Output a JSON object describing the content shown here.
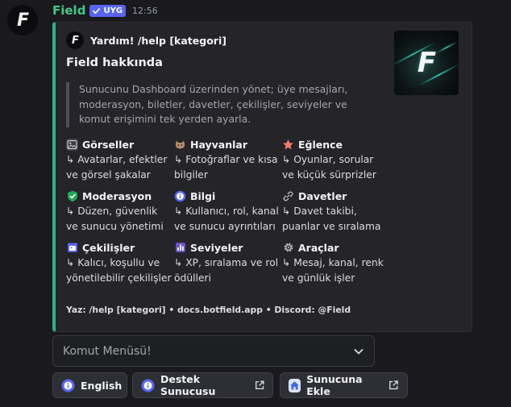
{
  "message": {
    "username": "Field",
    "badge": "UYG",
    "timestamp": "12:56",
    "username_color": "#40c98a",
    "badge_color": "#5865f2"
  },
  "embed": {
    "accent_color": "#2fb383",
    "author": "Yardım! /help [kategori]",
    "title": "Field hakkında",
    "description": "Sunucunu Dashboard üzerinden yönet; üye mesajları, moderasyon, biletler, davetler, çekilişler, seviyeler ve komut erişimini tek yerden ayarla.",
    "fields": [
      {
        "icon": "image-icon",
        "name": "Görseller",
        "value": "↳ Avatarlar, efektler ve görsel şakalar"
      },
      {
        "icon": "cat-icon",
        "name": "Hayvanlar",
        "value": "↳ Fotoğraflar ve kısa bilgiler"
      },
      {
        "icon": "star-icon",
        "name": "Eğlence",
        "value": "↳ Oyunlar, sorular ve küçük sürprizler"
      },
      {
        "icon": "shield-icon",
        "name": "Moderasyon",
        "value": "↳ Düzen, güvenlik ve sunucu yönetimi"
      },
      {
        "icon": "info-icon",
        "name": "Bilgi",
        "value": "↳ Kullanıcı, rol, kanal ve sunucu ayrıntıları"
      },
      {
        "icon": "link-icon",
        "name": "Davetler",
        "value": "↳ Davet takibi, puanlar ve sıralama"
      },
      {
        "icon": "calendar-icon",
        "name": "Çekilişler",
        "value": "↳ Kalıcı, koşullu ve yönetilebilir çekilişler"
      },
      {
        "icon": "bar-chart-icon",
        "name": "Seviyeler",
        "value": "↳ XP, sıralama ve rol ödülleri"
      },
      {
        "icon": "gear-icon",
        "name": "Araçlar",
        "value": "↳ Mesaj, kanal, renk ve günlük işler"
      }
    ],
    "footer": "Yaz: /help [kategori] • docs.botfield.app • Discord: @Field"
  },
  "components": {
    "select_placeholder": "Komut Menüsü!",
    "buttons": [
      {
        "label": "English",
        "icon": "info-icon"
      },
      {
        "label": "Destek Sunucusu",
        "icon": "info-icon",
        "external": true
      },
      {
        "label": "Sunucuna Ekle",
        "icon": "home-icon",
        "external": true
      }
    ]
  }
}
